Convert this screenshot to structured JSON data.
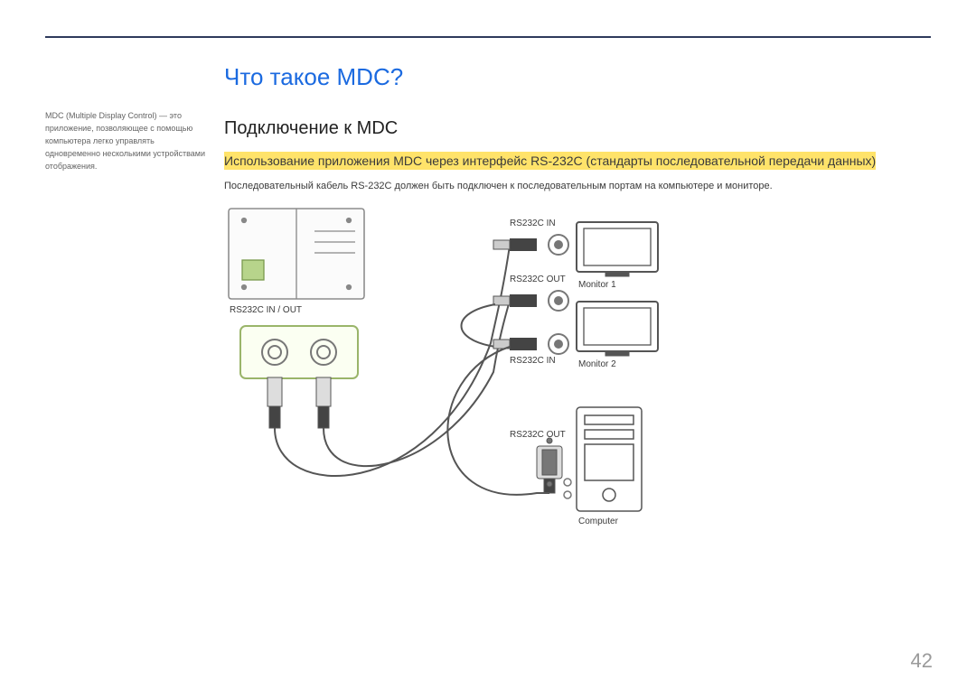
{
  "page": {
    "number": "42"
  },
  "sidebar": {
    "text": "MDC (Multiple Display Control) — это приложение, позволяющее с помощью компьютера легко управлять одновременно несколькими устройствами отображения."
  },
  "content": {
    "title": "Что такое MDC?",
    "subtitle": "Подключение к MDC",
    "highlight": "Использование приложения MDC через интерфейс RS-232C (стандарты последовательной передачи данных)",
    "body": "Последовательный кабель RS-232C должен быть подключен к последовательным портам на компьютере и мониторе."
  },
  "diagram": {
    "rs232c_in_out": "RS232C IN / OUT",
    "rs232c_in": "RS232C IN",
    "rs232c_out": "RS232C OUT",
    "monitor1": "Monitor 1",
    "monitor2": "Monitor 2",
    "computer": "Computer"
  }
}
